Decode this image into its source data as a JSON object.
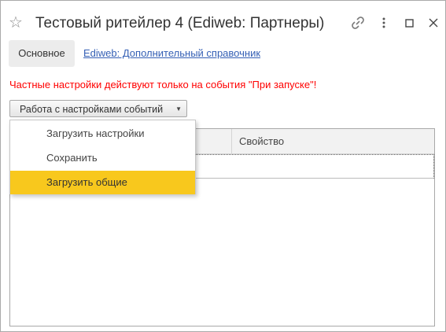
{
  "window": {
    "title": "Тестовый ритейлер 4 (Ediweb: Партнеры)"
  },
  "tabs": {
    "main_label": "Основное",
    "link_label": "Ediweb: Дополнительный справочник"
  },
  "warning": "Частные настройки действуют только на события \"При запуске\"!",
  "events_button": {
    "label": "Работа с настройками событий",
    "caret": "▼"
  },
  "grid": {
    "columns": [
      "",
      "Свойство"
    ]
  },
  "menu": {
    "items": [
      {
        "label": "Загрузить настройки"
      },
      {
        "label": "Сохранить"
      },
      {
        "label": "Загрузить общие"
      }
    ],
    "selected_index": 2
  },
  "colors": {
    "warning": "#ff0000",
    "link": "#3560b5",
    "selected": "#f8c81d"
  }
}
